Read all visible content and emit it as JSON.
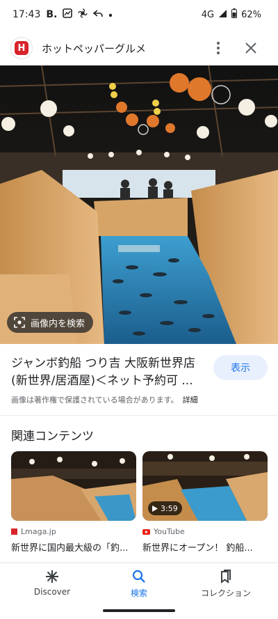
{
  "status_bar": {
    "time": "17:43",
    "network": "4G",
    "battery": "62%",
    "left_icons": [
      "B.",
      "photo-icon",
      "pinwheel-icon",
      "reply-icon",
      "dot-icon"
    ]
  },
  "header": {
    "app_title": "ホットペッパーグルメ",
    "app_icon": "H"
  },
  "hero": {
    "lens_label": "画像内を検索"
  },
  "result": {
    "title": "ジャンボ釣船 つり吉 大阪新世界店(新世界/居酒屋)＜ネット予約可 ...",
    "visit_label": "表示",
    "copyright": "画像は著作権で保護されている場合があります。",
    "details_label": "詳細"
  },
  "related": {
    "title": "関連コンテンツ",
    "cards": [
      {
        "source": "Lmaga.jp",
        "title": "新世界に国内最大級の「釣..."
      },
      {
        "source": "YouTube",
        "title": "新世界にオープン！ 釣船...",
        "duration": "3:59"
      }
    ]
  },
  "bottom_nav": [
    {
      "label": "Discover",
      "icon": "asterisk-icon"
    },
    {
      "label": "検索",
      "icon": "search-icon"
    },
    {
      "label": "コレクション",
      "icon": "bookmarks-icon"
    }
  ],
  "colors": {
    "accent": "#1a73e8",
    "chip_bg": "#e8f0fe",
    "brand_red": "#d8232a"
  }
}
